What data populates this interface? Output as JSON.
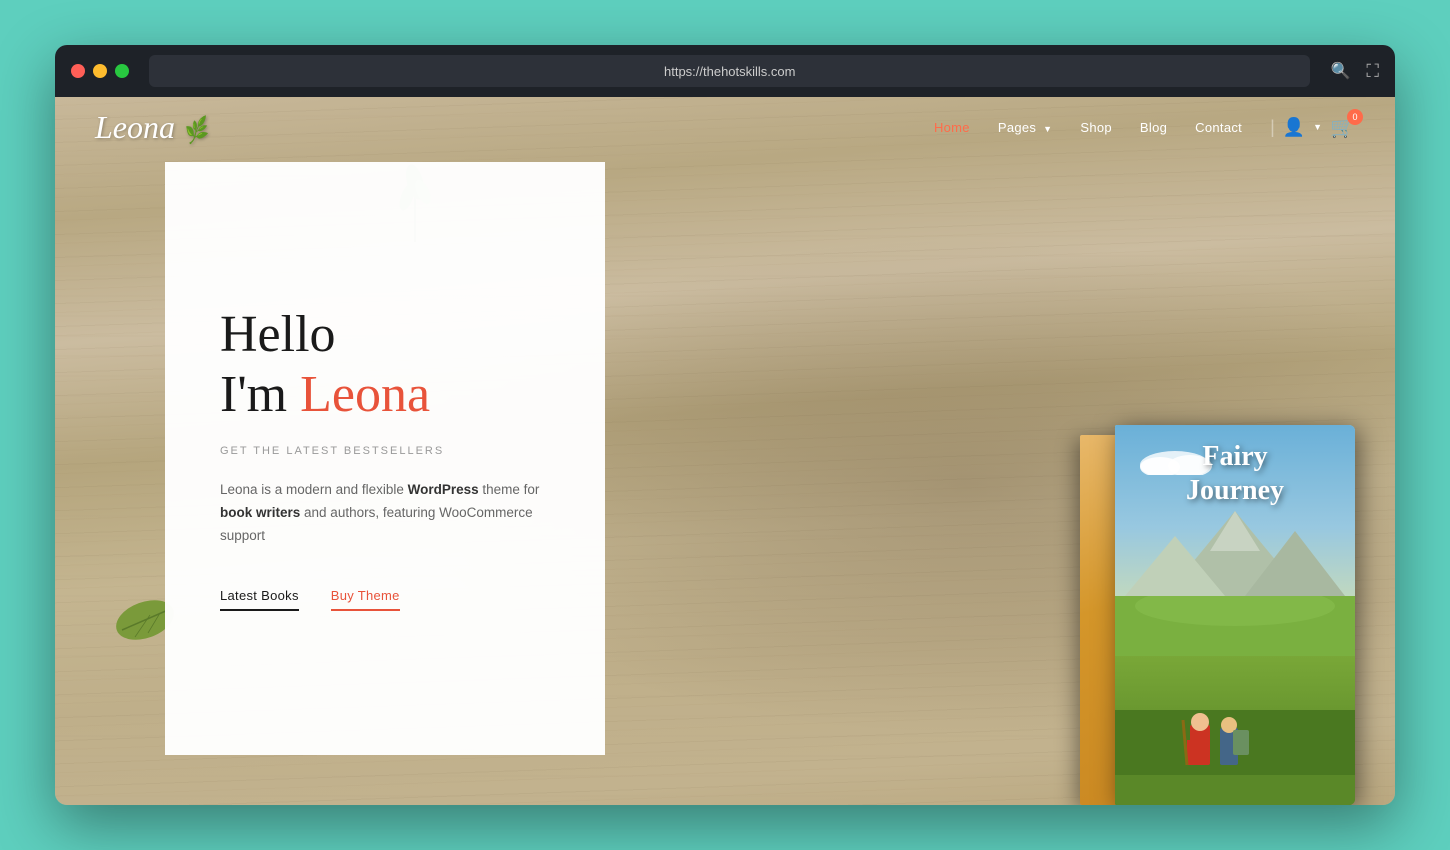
{
  "browser": {
    "url": "https://thehotskills.com",
    "search_icon": "🔍",
    "expand_icon": "⛶"
  },
  "nav": {
    "logo": "Leona",
    "logo_leaf": "🌿",
    "links": [
      {
        "label": "Home",
        "active": true
      },
      {
        "label": "Pages",
        "has_dropdown": true
      },
      {
        "label": "Shop"
      },
      {
        "label": "Blog"
      },
      {
        "label": "Contact"
      }
    ],
    "cart_count": "0"
  },
  "hero": {
    "hello": "Hello",
    "im": "I'm",
    "name": "Leona",
    "subtitle": "GET THE LATEST BESTSELLERS",
    "description_1": "Leona is a modern and flexible ",
    "description_bold_1": "WordPress",
    "description_2": " theme for ",
    "description_bold_2": "book writers",
    "description_3": " and authors, featuring WooCommerce support",
    "btn_latest": "Latest Books",
    "btn_buy": "Buy Theme"
  },
  "book": {
    "title_line1": "Fairy",
    "title_line2": "Journey"
  }
}
